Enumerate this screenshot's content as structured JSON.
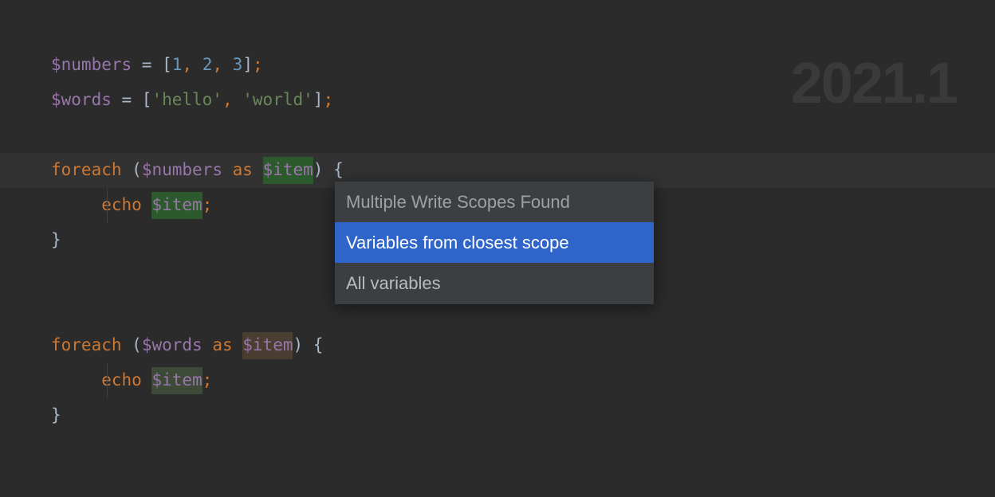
{
  "watermark": "2021.1",
  "code": {
    "line1": {
      "var": "$numbers",
      "eq": " = ",
      "lb": "[",
      "n1": "1",
      "c1": ", ",
      "n2": "2",
      "c2": ", ",
      "n3": "3",
      "rb": "]",
      "semi": ";"
    },
    "line2": {
      "var": "$words",
      "eq": " = ",
      "lb": "[",
      "s1": "'hello'",
      "c1": ", ",
      "s2": "'world'",
      "rb": "]",
      "semi": ";"
    },
    "line4": {
      "kw": "foreach",
      "sp1": " ",
      "lp": "(",
      "var1": "$numbers",
      "as": " as ",
      "var2": "$item",
      "rp": ")",
      "sp2": " ",
      "lb": "{"
    },
    "line5": {
      "indent": "     ",
      "echo": "echo",
      "sp": " ",
      "var": "$item",
      "semi": ";"
    },
    "line6": {
      "rb": "}"
    },
    "line9": {
      "kw": "foreach",
      "sp1": " ",
      "lp": "(",
      "var1": "$words",
      "as": " as ",
      "var2": "$item",
      "rp": ")",
      "sp2": " ",
      "lb": "{"
    },
    "line10": {
      "indent": "     ",
      "echo": "echo",
      "sp": " ",
      "var": "$item",
      "semi": ";"
    },
    "line11": {
      "rb": "}"
    }
  },
  "popup": {
    "title": "Multiple Write Scopes Found",
    "item1": "Variables from closest scope",
    "item2": "All variables"
  }
}
